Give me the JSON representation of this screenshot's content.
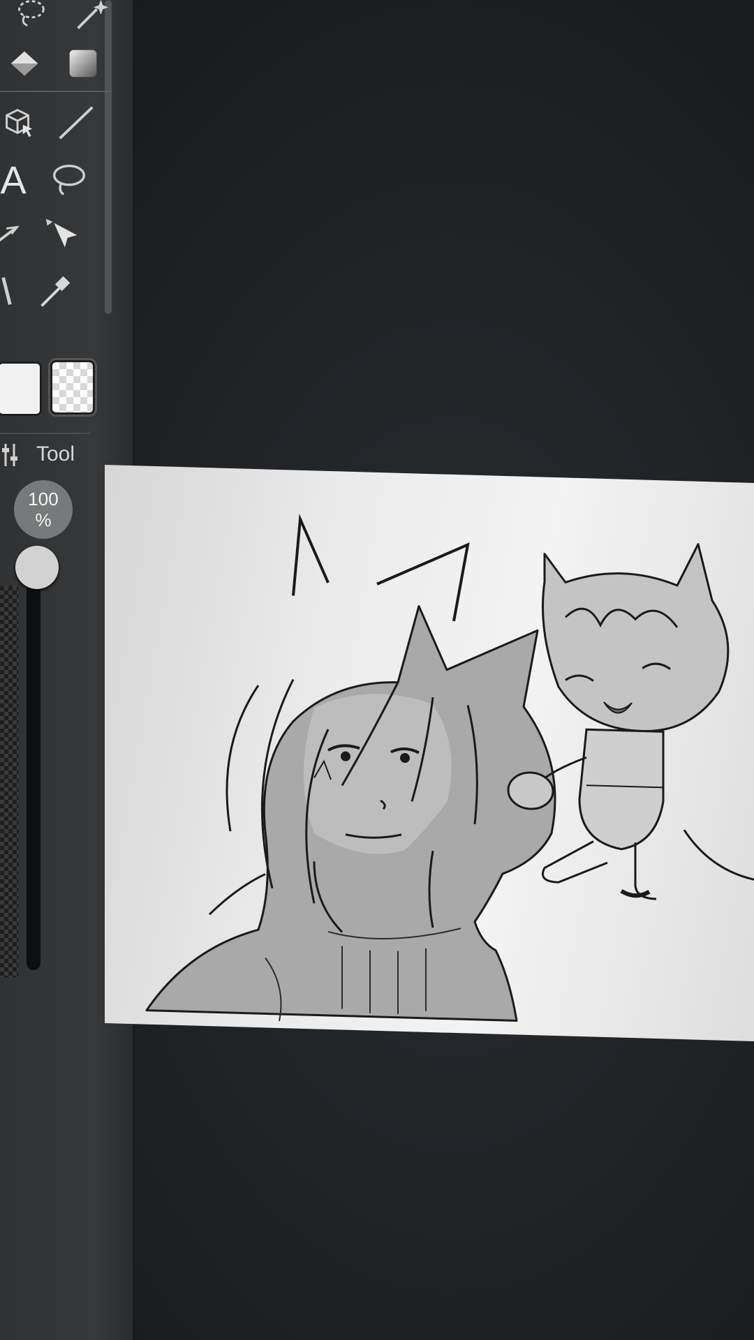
{
  "toolbar": {
    "tools": [
      {
        "icon": "lasso-select-icon"
      },
      {
        "icon": "magic-wand-icon"
      },
      {
        "icon": "fill-bucket-icon"
      },
      {
        "icon": "gradient-icon"
      },
      {
        "icon": "3d-select-icon"
      },
      {
        "icon": "line-icon"
      },
      {
        "icon": "text-icon"
      },
      {
        "icon": "lasso-icon"
      },
      {
        "icon": "pen-icon"
      },
      {
        "icon": "move-icon"
      },
      {
        "icon": "brush-icon"
      },
      {
        "icon": "eyedropper-icon"
      }
    ],
    "text_tool_glyph": "A",
    "tool_tab_label": "Tool",
    "opacity_value": "100",
    "opacity_unit": "%",
    "opacity_level": 1.0
  },
  "colors": {
    "toolbar_bg": "#343638",
    "canvas_bg": "#eeeeee",
    "ink": "#1a1a1a",
    "shade": "#a9a9a9"
  }
}
